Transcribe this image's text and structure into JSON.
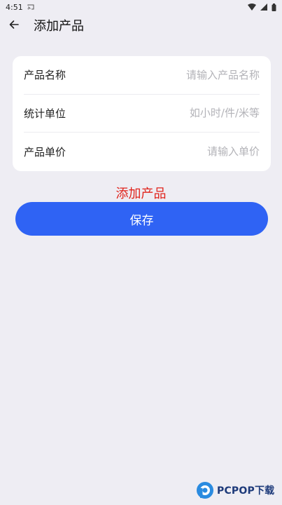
{
  "status_bar": {
    "time": "4:51"
  },
  "app_bar": {
    "title": "添加产品",
    "back_icon": "arrow-left-icon"
  },
  "form": {
    "fields": [
      {
        "label": "产品名称",
        "value": "",
        "placeholder": "请输入产品名称"
      },
      {
        "label": "统计单位",
        "value": "",
        "placeholder": "如小时/件/米等"
      },
      {
        "label": "产品单价",
        "value": "",
        "placeholder": "请输入单价"
      }
    ]
  },
  "annotation": "添加产品",
  "save_button": {
    "label": "保存"
  },
  "watermark": {
    "brand": "PCPOP下载"
  },
  "colors": {
    "background": "#eeedf3",
    "primary": "#2f63f4",
    "annotation": "#e0241c"
  }
}
